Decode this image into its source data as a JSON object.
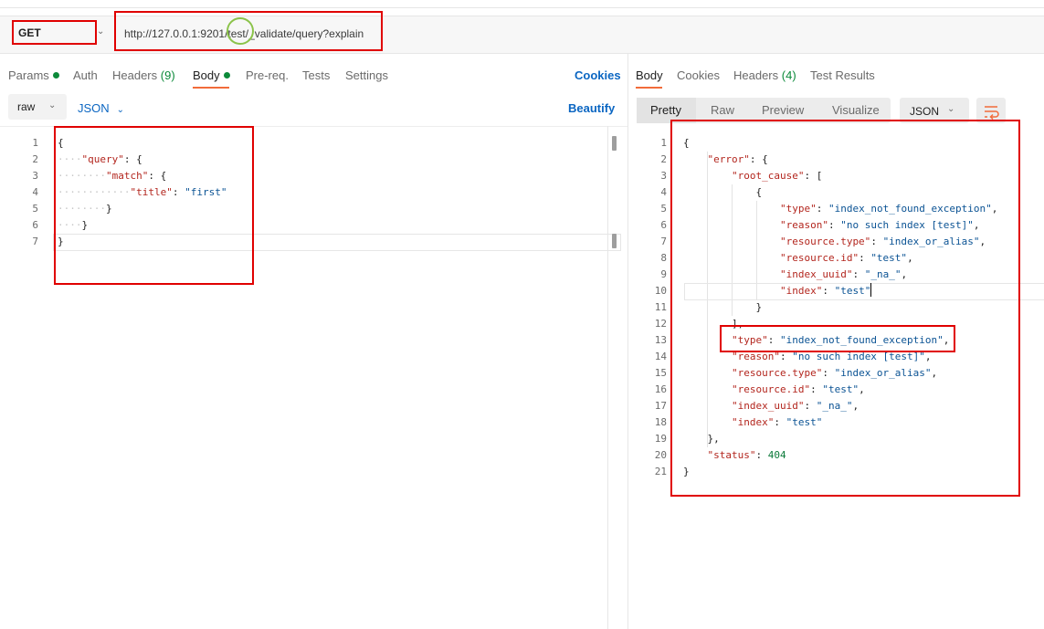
{
  "request": {
    "method": "GET",
    "url": "http://127.0.0.1:9201/test/_validate/query?explain"
  },
  "left_tabs": {
    "params": "Params",
    "auth": "Auth",
    "headers": "Headers",
    "headers_count": "(9)",
    "body": "Body",
    "prereq": "Pre-req.",
    "tests": "Tests",
    "settings": "Settings",
    "cookies": "Cookies"
  },
  "body_toolbar": {
    "mode": "raw",
    "language": "JSON",
    "beautify": "Beautify"
  },
  "request_body": {
    "line_numbers": [
      "1",
      "2",
      "3",
      "4",
      "5",
      "6",
      "7"
    ],
    "k_query": "\"query\"",
    "k_match": "\"match\"",
    "k_title": "\"title\"",
    "v_title": "\"first\""
  },
  "right_tabs": {
    "body": "Body",
    "cookies": "Cookies",
    "headers": "Headers",
    "headers_count": "(4)",
    "test_results": "Test Results"
  },
  "response_toolbar": {
    "pretty": "Pretty",
    "raw": "Raw",
    "preview": "Preview",
    "visualize": "Visualize",
    "format": "JSON"
  },
  "response_body": {
    "line_numbers": [
      "1",
      "2",
      "3",
      "4",
      "5",
      "6",
      "7",
      "8",
      "9",
      "10",
      "11",
      "12",
      "13",
      "14",
      "15",
      "16",
      "17",
      "18",
      "19",
      "20",
      "21"
    ],
    "k_error": "\"error\"",
    "k_root_cause": "\"root_cause\"",
    "k_type": "\"type\"",
    "k_reason": "\"reason\"",
    "k_resource_type": "\"resource.type\"",
    "k_resource_id": "\"resource.id\"",
    "k_index_uuid": "\"index_uuid\"",
    "k_index": "\"index\"",
    "k_status": "\"status\"",
    "v_type": "\"index_not_found_exception\"",
    "v_reason": "\"no such index [test]\"",
    "v_resource_type": "\"index_or_alias\"",
    "v_resource_id": "\"test\"",
    "v_index_uuid": "\"_na_\"",
    "v_index": "\"test\"",
    "v_status": "404"
  },
  "colors": {
    "highlight_red": "#e00000",
    "highlight_green": "#8bc34a",
    "accent_orange": "#f26b3a",
    "link_blue": "#0b66c2",
    "status_green": "#0c8a3a"
  },
  "icons": {
    "method_dropdown": "chevron-down-icon",
    "wrap": "wrap-lines-icon"
  }
}
